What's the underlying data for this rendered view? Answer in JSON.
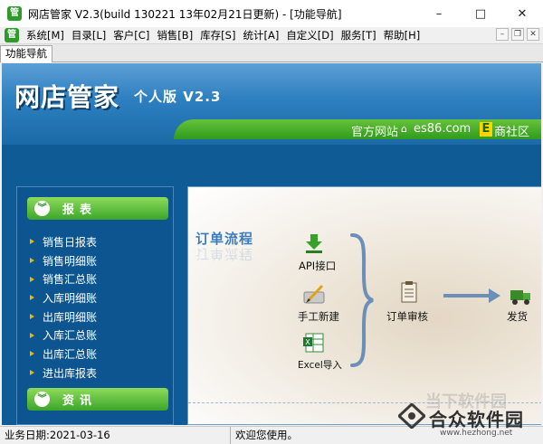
{
  "window": {
    "title": "网店管家 V2.3(build 130221 13年02月21日更新) - [功能导航]",
    "app_icon_glyph": "管",
    "controls": {
      "minimize": "–",
      "maximize": "□",
      "close": "✕"
    }
  },
  "menu": {
    "items": [
      "系统[M]",
      "目录[L]",
      "客户[C]",
      "销售[B]",
      "库存[S]",
      "统计[A]",
      "自定义[D]",
      "服务[T]",
      "帮助[H]"
    ],
    "mdi_controls": {
      "minimize": "–",
      "restore": "❐",
      "close": "✕"
    }
  },
  "tab": {
    "label": "功能导航"
  },
  "header": {
    "logo": "网店管家",
    "edition": "个人版 V2.3",
    "site_label": "官方网站",
    "site_domain": "es86.com",
    "e_glyph": "E",
    "community": "商社区"
  },
  "leftnav": {
    "section1": "报表",
    "items": [
      "销售日报表",
      "销售明细账",
      "销售汇总账",
      "入库明细账",
      "出库明细账",
      "入库汇总账",
      "出库汇总账",
      "进出库报表"
    ],
    "section2": "资讯"
  },
  "content": {
    "flow_title": "订单流程",
    "sources": [
      "API接口",
      "手工新建",
      "Excel导入"
    ],
    "review": "订单审核",
    "ship": "发货"
  },
  "status": {
    "business_date": "业务日期:2021-03-16",
    "welcome": "欢迎您使用。"
  },
  "watermark": {
    "ghost": "当下软件园",
    "main": "合众软件园",
    "url": "www.hezhong.net"
  },
  "colors": {
    "main_blue": "#0f5b95",
    "nav_green": "#3ba52a",
    "flow_blue": "#3b7cc0"
  }
}
